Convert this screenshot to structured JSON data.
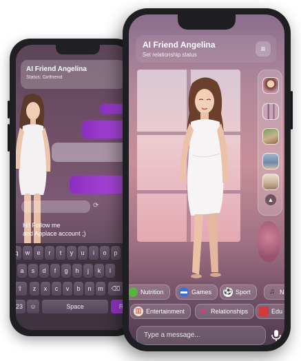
{
  "back_phone": {
    "title": "AI Friend Angelina",
    "status": "Status: Girlfriend",
    "message_line1": "Hi! Follow me",
    "message_line2": "and Applace account ;)",
    "keyboard": {
      "row1": [
        "q",
        "w",
        "e",
        "r",
        "t",
        "y",
        "u",
        "i",
        "o",
        "p"
      ],
      "row2": [
        "a",
        "s",
        "d",
        "f",
        "g",
        "h",
        "j",
        "k",
        "l"
      ],
      "row3": [
        "z",
        "x",
        "c",
        "v",
        "b",
        "n",
        "m"
      ],
      "numbers_key": "23",
      "space_label": "Space",
      "return_label": "R"
    }
  },
  "front_phone": {
    "title": "AI Friend Angelina",
    "subtitle": "Set relationship status",
    "chips_row1": [
      {
        "label": "Nutrition",
        "icon": "apple-icon"
      },
      {
        "label": "Games",
        "icon": "gamepad-icon"
      },
      {
        "label": "Sport",
        "icon": "soccer-ball-icon"
      },
      {
        "label": "N",
        "icon": "music-icon"
      }
    ],
    "chips_row2": [
      {
        "label": "Entertainment",
        "icon": "popcorn-icon"
      },
      {
        "label": "Relationships",
        "icon": "heart-icon"
      },
      {
        "label": "Edu",
        "icon": "book-icon"
      }
    ],
    "input_placeholder": "Type a message...",
    "colors": {
      "accent_purple": "#9b3fd4",
      "heart_pink": "#e8337a"
    }
  }
}
